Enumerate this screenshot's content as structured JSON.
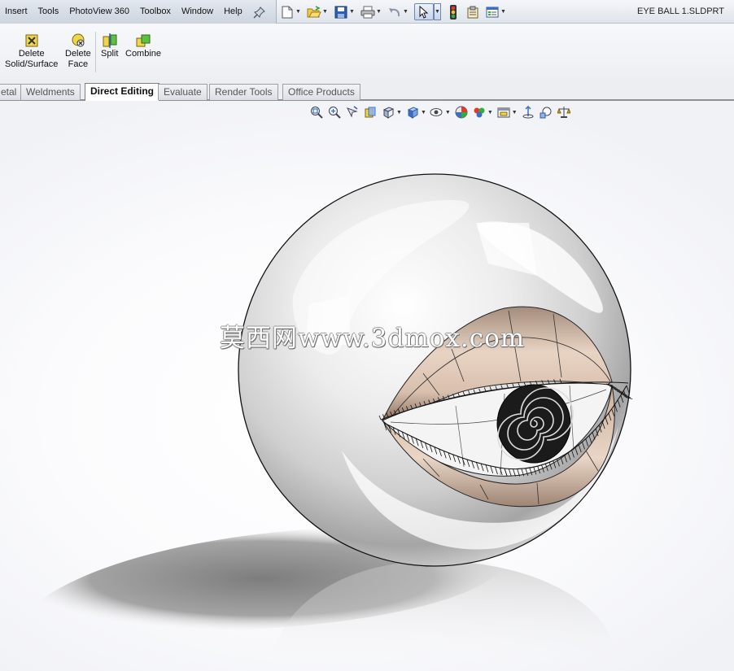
{
  "menu": {
    "items": [
      "Insert",
      "Tools",
      "PhotoView 360",
      "Toolbox",
      "Window",
      "Help"
    ],
    "pin_icon": "pushpin-icon"
  },
  "quick_access": {
    "icons": [
      "new-document-icon",
      "open-folder-icon",
      "save-icon",
      "print-icon",
      "undo-icon",
      "select-cursor-icon",
      "rebuild-traffic-light-icon",
      "file-properties-icon",
      "options-icon"
    ]
  },
  "document": {
    "title": "EYE BALL 1.SLDPRT"
  },
  "command_manager": {
    "tools": [
      {
        "label_line1": "Delete",
        "label_line2": "Solid/Surface",
        "icon": "delete-solid-icon"
      },
      {
        "label_line1": "Delete",
        "label_line2": "Face",
        "icon": "delete-face-icon"
      },
      {
        "label_line1": "Split",
        "label_line2": "",
        "icon": "split-icon"
      },
      {
        "label_line1": "Combine",
        "label_line2": "",
        "icon": "combine-icon"
      }
    ]
  },
  "tabs": [
    {
      "label": "etal",
      "active": false
    },
    {
      "label": "Weldments",
      "active": false
    },
    {
      "label": "Direct Editing",
      "active": true
    },
    {
      "label": "Evaluate",
      "active": false
    },
    {
      "label": "Render Tools",
      "active": false
    },
    {
      "label": "Office Products",
      "active": false
    }
  ],
  "heads_up_toolbar": {
    "icons": [
      "zoom-to-fit-icon",
      "zoom-to-area-icon",
      "previous-view-icon",
      "section-view-icon",
      "view-orientation-icon",
      "display-style-icon",
      "hide-show-items-icon",
      "edit-appearance-icon",
      "apply-scene-icon",
      "view-settings-icon",
      "rotate-view-icon",
      "zoom-in-out-icon",
      "scale-icon"
    ]
  },
  "viewport": {
    "watermark": "莫西网www.3dmox.com",
    "colors": {
      "eyelid": "#dcc3b2",
      "sphere": "#f2f2f2",
      "iris": "#1a1a1a"
    }
  }
}
